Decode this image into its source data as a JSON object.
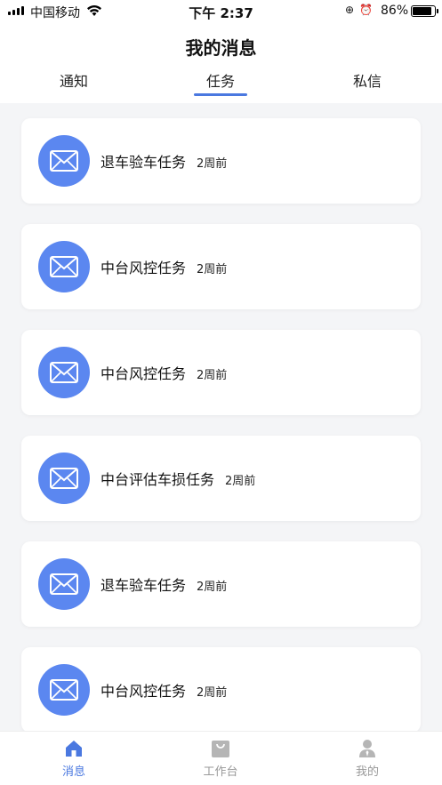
{
  "status_bar": {
    "carrier": "中国移动",
    "time": "下午 2:37",
    "battery": "86%",
    "battery_level": 0.86
  },
  "header": {
    "title": "我的消息",
    "tabs": [
      {
        "label": "通知",
        "active": false
      },
      {
        "label": "任务",
        "active": true
      },
      {
        "label": "私信",
        "active": false
      }
    ]
  },
  "messages": [
    {
      "title": "退车验车任务",
      "time": "2周前",
      "icon": "mail-icon"
    },
    {
      "title": "中台风控任务",
      "time": "2周前",
      "icon": "mail-icon"
    },
    {
      "title": "中台风控任务",
      "time": "2周前",
      "icon": "mail-icon"
    },
    {
      "title": "中台评估车损任务",
      "time": "2周前",
      "icon": "mail-icon"
    },
    {
      "title": "退车验车任务",
      "time": "2周前",
      "icon": "mail-icon"
    },
    {
      "title": "中台风控任务",
      "time": "2周前",
      "icon": "mail-icon"
    }
  ],
  "tabbar": {
    "items": [
      {
        "label": "消息",
        "icon": "home-icon",
        "active": true
      },
      {
        "label": "工作台",
        "icon": "workbench-icon",
        "active": false
      },
      {
        "label": "我的",
        "icon": "profile-icon",
        "active": false
      }
    ]
  },
  "colors": {
    "accent": "#4a78e0",
    "avatar_bg": "#5b87f0",
    "page_bg": "#f4f5f7",
    "inactive": "#999999"
  }
}
